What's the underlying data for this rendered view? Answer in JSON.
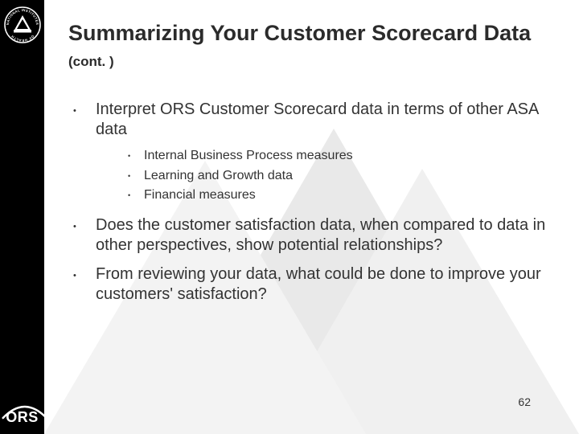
{
  "slide": {
    "title_main": "Summarizing Your Customer Scorecard Data",
    "title_cont": "(cont. )",
    "bullets": [
      {
        "text": "Interpret ORS Customer Scorecard data in terms of other ASA data",
        "sub": [
          {
            "text": "Internal Business Process measures"
          },
          {
            "text": "Learning and Growth data"
          },
          {
            "text": "Financial measures"
          }
        ]
      },
      {
        "text": "Does the customer satisfaction data, when compared to data in other perspectives, show potential relationships?"
      },
      {
        "text": "From reviewing your data, what could be done to improve your customers' satisfaction?"
      }
    ],
    "page_number": "62",
    "logo": {
      "nih_name": "NATIONAL INSTITUTES OF HEALTH",
      "ors_label": "ORS"
    }
  }
}
